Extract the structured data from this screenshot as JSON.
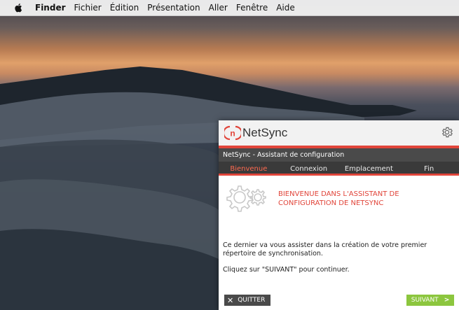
{
  "menubar": {
    "apple_icon": "apple-icon",
    "app_name": "Finder",
    "items": [
      "Fichier",
      "Édition",
      "Présentation",
      "Aller",
      "Fenêtre",
      "Aide"
    ]
  },
  "window": {
    "app_name": "NetSync",
    "logo_letter": "n",
    "settings_icon": "gear-icon",
    "title": "NetSync - Assistant de configuration",
    "tabs": [
      {
        "label": "Bienvenue",
        "active": true
      },
      {
        "label": "Connexion",
        "active": false
      },
      {
        "label": "Emplacement",
        "active": false
      },
      {
        "label": "Fin",
        "active": false
      }
    ],
    "welcome_line1": "BIENVENUE DANS L'ASSISTANT DE",
    "welcome_line2": "CONFIGURATION DE NETSYNC",
    "paragraph1": "Ce dernier va vous assister dans la création de votre premier répertoire de synchronisation.",
    "paragraph2": "Cliquez sur \"SUIVANT\" pour continuer.",
    "quit_label": "QUITTER",
    "next_label": "SUIVANT",
    "next_chevron": ">"
  },
  "colors": {
    "accent": "#e1453a",
    "next_button": "#8cc63e",
    "dark_bar": "#4a4a4a"
  }
}
